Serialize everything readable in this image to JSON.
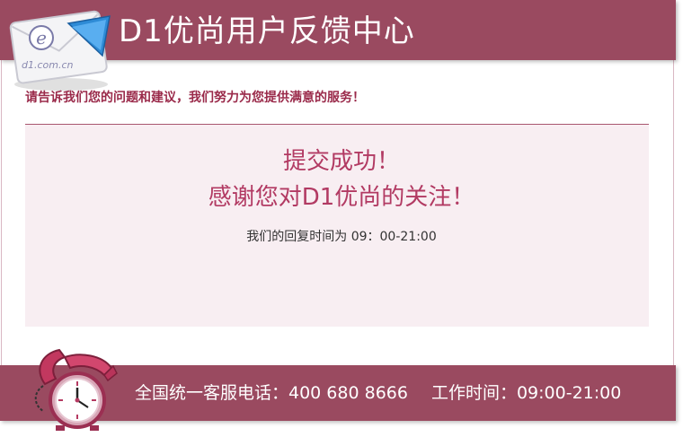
{
  "header": {
    "title": "D1优尚用户反馈中心",
    "icon": "mail-envelope-icon",
    "icon_text": "e",
    "icon_subtext": "d1.com.cn"
  },
  "subtitle": "请告诉我们您的问题和建议，我们努力为您提供满意的服务！",
  "result": {
    "line1": "提交成功！",
    "line2": "感谢您对D1优尚的关注！",
    "reply_hours_note": "我们的回复时间为 09：00-21:00"
  },
  "footer": {
    "hotline": "全国统一客服电话：400 680 8666",
    "working_hours": "工作时间：09:00-21:00",
    "icon": "phone-clock-icon"
  },
  "colors": {
    "brand": "#9a4a60",
    "accent_text": "#b23a63",
    "panel_bg": "#f8eef2"
  }
}
